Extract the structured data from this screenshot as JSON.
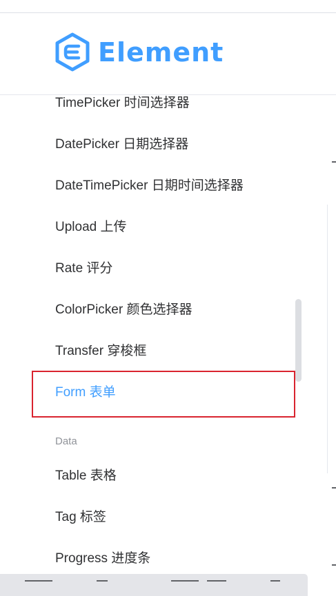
{
  "brand": {
    "name": "Element",
    "color": "#409eff"
  },
  "menu": {
    "items": [
      {
        "label": "TimePicker 时间选择器"
      },
      {
        "label": "DatePicker 日期选择器"
      },
      {
        "label": "DateTimePicker 日期时间选择器"
      },
      {
        "label": "Upload 上传"
      },
      {
        "label": "Rate 评分"
      },
      {
        "label": "ColorPicker 颜色选择器"
      },
      {
        "label": "Transfer 穿梭框"
      },
      {
        "label": "Form 表单",
        "active": true
      }
    ],
    "group_data": {
      "title": "Data",
      "items": [
        {
          "label": "Table 表格"
        },
        {
          "label": "Tag 标签"
        },
        {
          "label": "Progress 进度条"
        }
      ]
    }
  },
  "colors": {
    "active": "#409eff",
    "highlight_border": "#d9232e",
    "text": "#303133",
    "group_title": "#909399"
  }
}
